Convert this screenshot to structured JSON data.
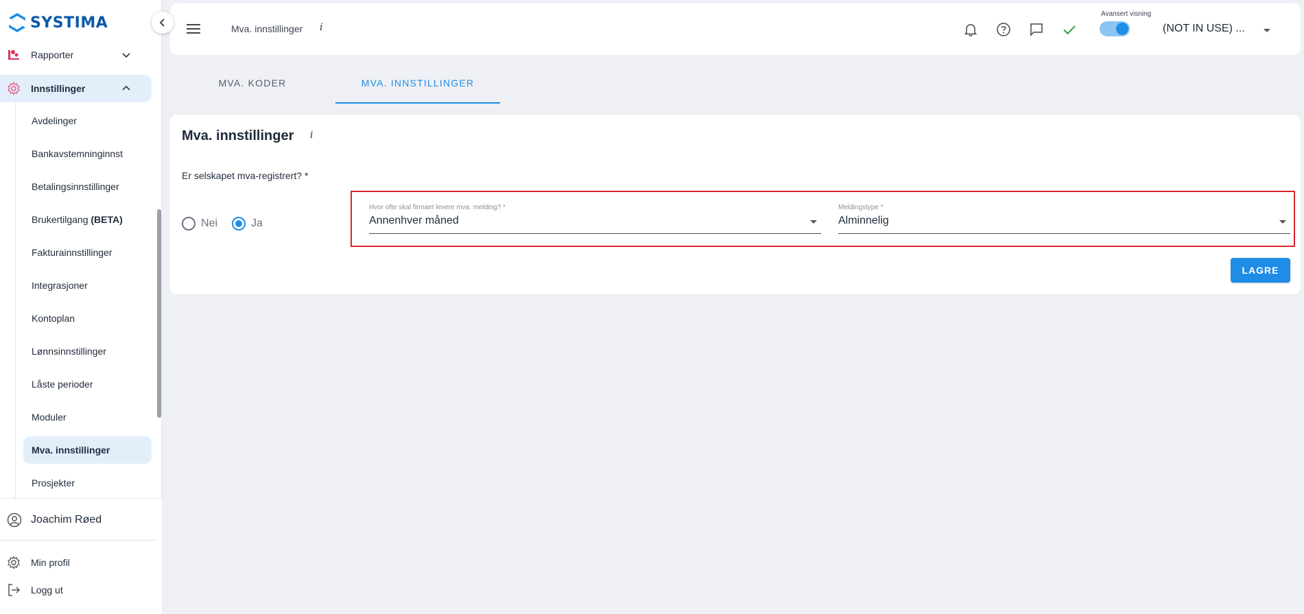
{
  "brand": {
    "name": "SYSTIMA"
  },
  "sidebar": {
    "items": [
      {
        "label": "Rapporter",
        "icon": "report-icon"
      },
      {
        "label": "Innstillinger",
        "icon": "settings-icon"
      }
    ],
    "subitems": [
      {
        "label": "Avdelinger"
      },
      {
        "label": "Bankavstemninginnst"
      },
      {
        "label": "Betalingsinnstillinger"
      },
      {
        "label": "Brukertilgang "
      },
      {
        "label": "Fakturainnstillinger"
      },
      {
        "label": "Integrasjoner"
      },
      {
        "label": "Kontoplan"
      },
      {
        "label": "Lønnsinnstillinger"
      },
      {
        "label": "Låste perioder"
      },
      {
        "label": "Moduler"
      },
      {
        "label": "Mva. innstillinger"
      },
      {
        "label": "Prosjekter"
      }
    ],
    "beta_tag": "(BETA)",
    "user_name": "Joachim Røed",
    "profile_label": "Min profil",
    "logout_label": "Logg ut"
  },
  "topbar": {
    "title": "Mva. innstillinger",
    "info": "i",
    "advanced_label": "Avansert visning",
    "advanced_on": true,
    "company": "(NOT IN USE) ..."
  },
  "tabs": [
    {
      "label": "MVA. KODER"
    },
    {
      "label": "MVA. INNSTILLINGER"
    }
  ],
  "card": {
    "title": "Mva. innstillinger",
    "info": "i",
    "question": "Er selskapet mva-registrert? *",
    "radio_no": "Nei",
    "radio_yes": "Ja",
    "selected": "Ja",
    "frequency": {
      "label": "Hvor ofte skal firmaet levere mva. melding? *",
      "value": "Annenhver måned"
    },
    "report_type": {
      "label": "Meldingstype *",
      "value": "Alminnelig"
    },
    "save_label": "LAGRE"
  },
  "colors": {
    "accent": "#1f8ce6",
    "highlight": "#d9252b",
    "active_bg": "#e2effb",
    "check": "#2e9e4a"
  }
}
